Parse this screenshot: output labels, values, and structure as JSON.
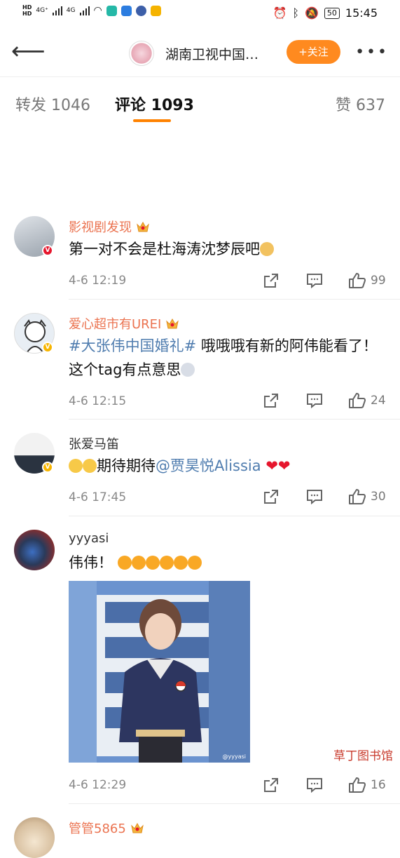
{
  "status": {
    "network1": "4G⁺",
    "network2": "4G",
    "battery": "50",
    "time": "15:45"
  },
  "header": {
    "title": "湖南卫视中国…",
    "follow_label": "+关注",
    "more_label": "•••"
  },
  "tabs": [
    {
      "label": "转发 1046"
    },
    {
      "label": "评论 1093"
    },
    {
      "label": "赞 637"
    }
  ],
  "comments": [
    {
      "user": "影视剧发现",
      "text": "第一对不会是杜海涛沈梦辰吧",
      "time": "4-6 12:19",
      "likes": "99"
    },
    {
      "user": "爱心超市有UREI",
      "hashtag": "#大张伟中国婚礼#",
      "text": " 哦哦哦有新的阿伟能看了！这个tag有点意思",
      "time": "4-6 12:15",
      "likes": "24"
    },
    {
      "user": "张爱马笛",
      "text_pre": "期待期待",
      "mention": "@贾昊悦Alissia",
      "time": "4-6 17:45",
      "likes": "30"
    },
    {
      "user": "yyyasi",
      "text": "伟伟！",
      "time": "4-6 12:29",
      "likes": "16",
      "photo_watermark": "@yyyasi"
    },
    {
      "user": "管管5865"
    }
  ],
  "watermark": "草丁图书馆"
}
